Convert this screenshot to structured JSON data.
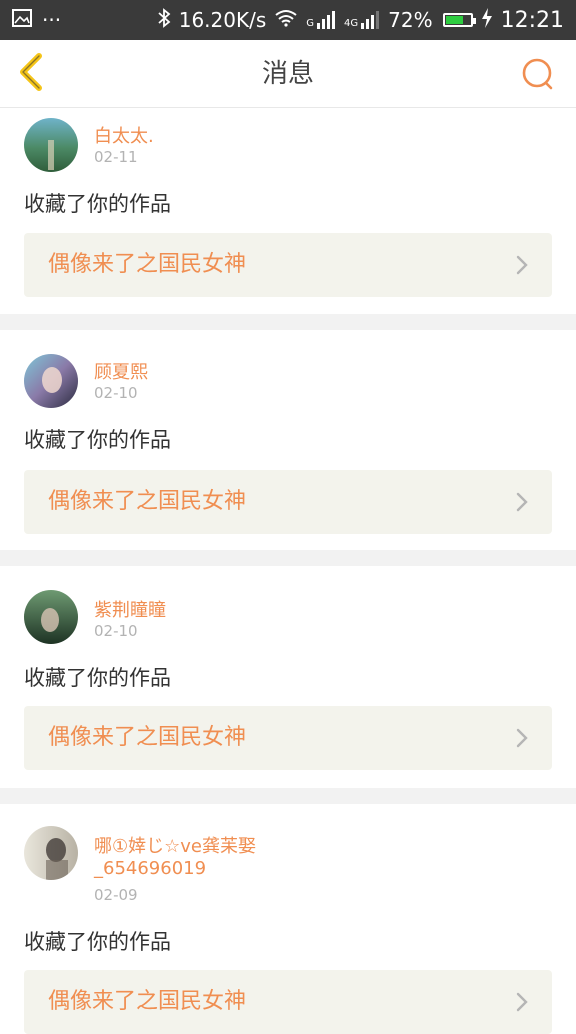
{
  "status_bar": {
    "network_speed": "16.20K/s",
    "sim1_label": "G",
    "sim2_label": "4G",
    "battery_percent": "72%",
    "battery_level": 0.72,
    "time": "12:21",
    "more_dots": "···"
  },
  "header": {
    "title": "消息",
    "back_icon": "chevron-left-icon",
    "search_icon": "search-icon"
  },
  "colors": {
    "accent": "#f08e51",
    "back_icon": "#f5c518",
    "card_bg": "#f3f3ec",
    "separator": "#f2f2f2"
  },
  "notifications": [
    {
      "username": "白太太.",
      "date": "02-11",
      "action": "收藏了你的作品",
      "work_title": "偶像来了之国民女神"
    },
    {
      "username": "顾夏熙",
      "date": "02-10",
      "action": "收藏了你的作品",
      "work_title": "偶像来了之国民女神"
    },
    {
      "username": "紫荆瞳瞳",
      "date": "02-10",
      "action": "收藏了你的作品",
      "work_title": "偶像来了之国民女神"
    },
    {
      "username_line1": "哪①婞じ☆ve龚苿娶",
      "username_line2": "_654696019",
      "date": "02-09",
      "action": "收藏了你的作品",
      "work_title": "偶像来了之国民女神"
    }
  ]
}
